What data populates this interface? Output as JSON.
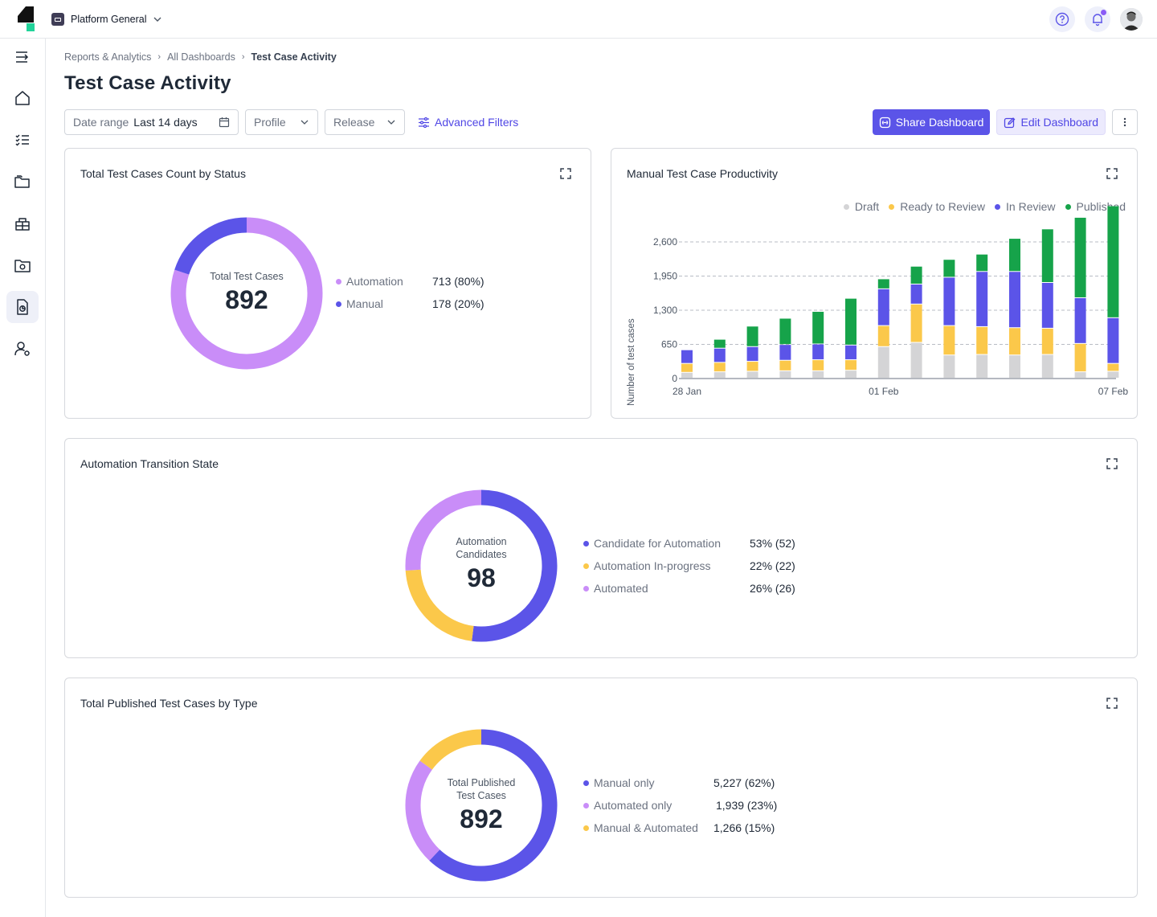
{
  "header": {
    "project_name": "Platform General"
  },
  "breadcrumb": [
    "Reports & Analytics",
    "All Dashboards",
    "Test Case Activity"
  ],
  "page_title": "Test Case Activity",
  "filters": {
    "date_label": "Date range",
    "date_value": "Last 14 days",
    "profile": "Profile",
    "release": "Release",
    "advanced": "Advanced Filters"
  },
  "actions": {
    "share": "Share Dashboard",
    "edit": "Edit Dashboard"
  },
  "colors": {
    "accent": "#5b54e8",
    "purple_light": "#c98df8",
    "indigo": "#5b54e8",
    "yellow": "#fbc84a",
    "green": "#16a34a",
    "draft_gray": "#d4d4d6"
  },
  "icons": [
    "logo",
    "chevron-down-icon",
    "help-icon",
    "bell-icon",
    "avatar",
    "menu-expand-icon",
    "home-icon",
    "checklist-icon",
    "folder-icon",
    "bug-icon",
    "settings-folder-icon",
    "report-icon",
    "user-settings-icon",
    "calendar-icon",
    "sliders-icon",
    "share-icon",
    "edit-icon",
    "more-icon",
    "expand-icon"
  ],
  "cards": {
    "status": {
      "title": "Total Test Cases Count by Status",
      "center_label": "Total Test Cases",
      "center_value": "892",
      "legend": [
        {
          "label": "Automation",
          "value": "713 (80%)",
          "color": "#c98df8"
        },
        {
          "label": "Manual",
          "value": "178 (20%)",
          "color": "#5b54e8"
        }
      ]
    },
    "productivity": {
      "title": "Manual Test Case Productivity"
    },
    "transition": {
      "title": "Automation Transition State",
      "center_label_1": "Automation",
      "center_label_2": "Candidates",
      "center_value": "98",
      "legend": [
        {
          "label": "Candidate for Automation",
          "value": "53% (52)",
          "color": "#5b54e8"
        },
        {
          "label": "Automation In-progress",
          "value": "22% (22)",
          "color": "#fbc84a"
        },
        {
          "label": "Automated",
          "value": "26% (26)",
          "color": "#c98df8"
        }
      ]
    },
    "published": {
      "title": "Total Published Test Cases by Type",
      "center_label_1": "Total Published",
      "center_label_2": "Test Cases",
      "center_value": "892",
      "legend": [
        {
          "label": "Manual only",
          "value": "5,227 (62%)",
          "color": "#5b54e8"
        },
        {
          "label": "Automated only",
          "value": "1,939 (23%)",
          "color": "#c98df8"
        },
        {
          "label": "Manual & Automated",
          "value": "1,266 (15%)",
          "color": "#fbc84a"
        }
      ]
    }
  },
  "chart_data": [
    {
      "type": "pie",
      "title": "Total Test Cases Count by Status",
      "categories": [
        "Automation",
        "Manual"
      ],
      "values": [
        713,
        178
      ]
    },
    {
      "type": "bar",
      "stacked": true,
      "title": "Manual Test Case Productivity",
      "ylabel": "Number of test cases",
      "ylim": [
        0,
        2600
      ],
      "yticks": [
        "2,600",
        "1,950",
        "1,300",
        "650",
        "0"
      ],
      "ytick_values": [
        2600,
        1950,
        1300,
        650,
        0
      ],
      "xtick_labels": [
        "28 Jan",
        "01 Feb",
        "07 Feb"
      ],
      "xtick_index": [
        0,
        6,
        13
      ],
      "grid": true,
      "legend_position": "top-right",
      "series": [
        {
          "name": "Draft",
          "color": "#d4d4d6",
          "values": [
            110,
            120,
            130,
            140,
            140,
            150,
            600,
            680,
            440,
            450,
            440,
            450,
            120,
            130
          ]
        },
        {
          "name": "Ready to Review",
          "color": "#fbc84a",
          "values": [
            170,
            180,
            190,
            200,
            210,
            200,
            400,
            730,
            560,
            530,
            520,
            500,
            540,
            150
          ]
        },
        {
          "name": "In Review",
          "color": "#5b54e8",
          "values": [
            260,
            270,
            280,
            300,
            300,
            280,
            700,
            380,
            920,
            1050,
            1070,
            870,
            870,
            870
          ]
        },
        {
          "name": "Published",
          "color": "#16a34a",
          "values": [
            0,
            170,
            390,
            500,
            620,
            890,
            190,
            340,
            340,
            330,
            630,
            1020,
            1530,
            2130
          ]
        }
      ]
    },
    {
      "type": "pie",
      "title": "Automation Transition State",
      "categories": [
        "Candidate for Automation",
        "Automation In-progress",
        "Automated"
      ],
      "values": [
        52,
        22,
        26
      ]
    },
    {
      "type": "pie",
      "title": "Total Published Test Cases by Type",
      "categories": [
        "Manual only",
        "Automated only",
        "Manual & Automated"
      ],
      "values": [
        5227,
        1939,
        1266
      ]
    }
  ]
}
